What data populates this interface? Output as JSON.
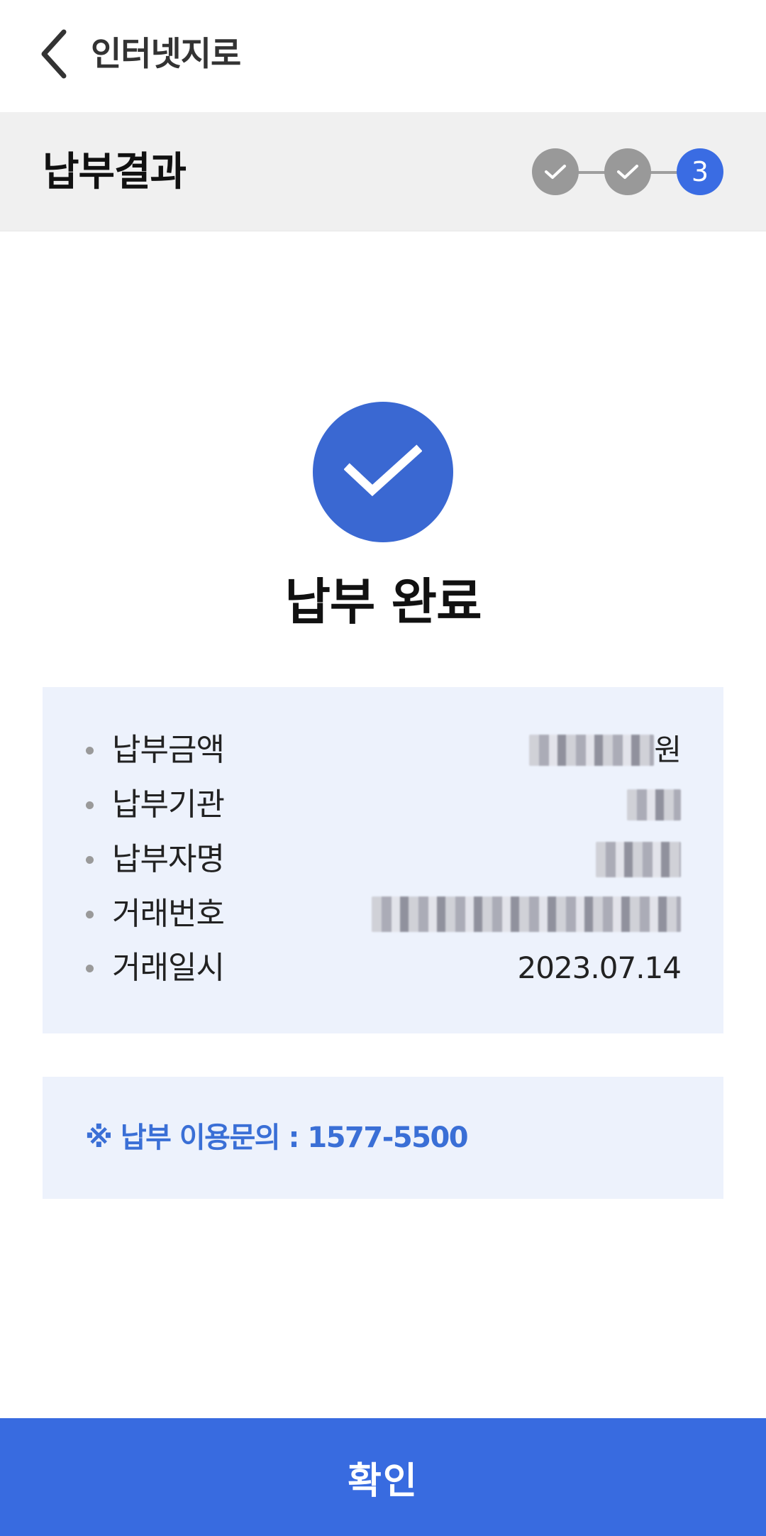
{
  "header": {
    "title": "인터넷지로",
    "back_icon": "chevron-left-icon"
  },
  "stepbar": {
    "title": "납부결과",
    "steps": [
      {
        "status": "done",
        "icon": "check-icon"
      },
      {
        "status": "done",
        "icon": "check-icon"
      },
      {
        "status": "current",
        "label": "3"
      }
    ],
    "colors": {
      "done": "#999999",
      "current": "#3a6ce3",
      "line": "#9e9e9e"
    }
  },
  "result": {
    "icon": "check-circle-icon",
    "title": "납부 완료",
    "accent": "#3a68d2"
  },
  "details": {
    "rows": [
      {
        "label": "납부금액",
        "value_suffix": "원",
        "value_masked": true
      },
      {
        "label": "납부기관",
        "value_masked": true
      },
      {
        "label": "납부자명",
        "value_masked": true
      },
      {
        "label": "거래번호",
        "value_masked": true
      },
      {
        "label": "거래일시",
        "value": "2023.07.14"
      }
    ]
  },
  "contact": {
    "text": "※ 납부 이용문의 : 1577-5500"
  },
  "footer": {
    "confirm_label": "확인",
    "color": "#386be0"
  }
}
